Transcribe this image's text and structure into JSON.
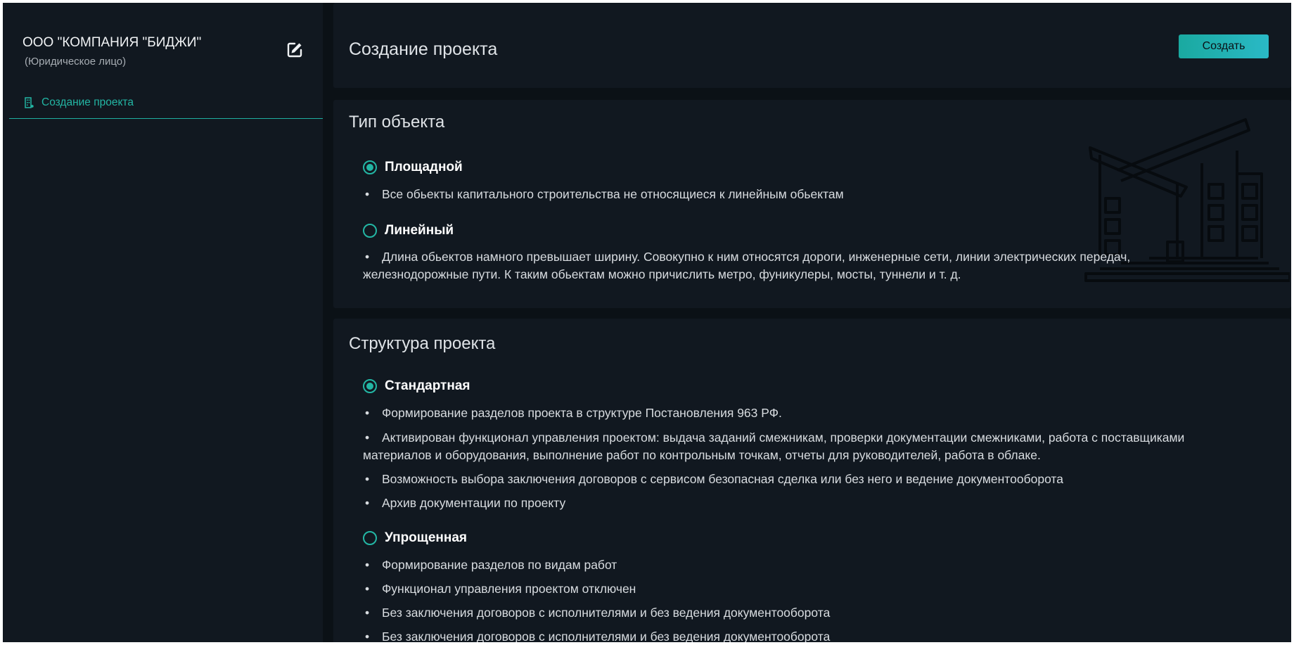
{
  "sidebar": {
    "org_name": "ООО \"КОМПАНИЯ \"БИДЖИ\"",
    "org_type": "(Юридическое лицо)",
    "nav_item": "Создание проекта"
  },
  "header": {
    "title": "Создание проекта",
    "create_button": "Создать"
  },
  "object_type": {
    "title": "Тип объекта",
    "options": [
      {
        "label": "Площадной",
        "selected": true,
        "bullets": [
          "Все обьекты капитального строительства не относящиеся к линейным обьектам"
        ]
      },
      {
        "label": "Линейный",
        "selected": false,
        "bullets": [
          "Длина обьектов намного превышает ширину. Совокупно к ним относятся дороги, инженерные сети, линии электрических передач, железнодорожные пути. К таким обьектам можно причислить метро, фуникулеры, мосты, туннели и т. д."
        ]
      }
    ]
  },
  "structure": {
    "title": "Структура проекта",
    "options": [
      {
        "label": "Стандартная",
        "selected": true,
        "bullets": [
          "Формирование разделов проекта в структуре Постановления 963 РФ.",
          "Активирован функционал управления проектом: выдача заданий смежникам, проверки документации смежниками, работа с поставщиками материалов и оборудования, выполнение работ по контрольным точкам, отчеты для руководителей, работа в облаке.",
          "Возможность выбора заключения договоров с сервисом безопасная сделка или без него и ведение документооборота",
          "Архив документации по проекту"
        ]
      },
      {
        "label": "Упрощенная",
        "selected": false,
        "bullets": [
          "Формирование разделов по видам работ",
          "Функционал управления проектом отключен",
          "Без заключения договоров с исполнителями и без ведения документооборота",
          "Без заключения договоров с исполнителями и без ведения документооборота"
        ]
      }
    ]
  },
  "icons": {
    "edit": "edit-icon",
    "nav": "building-icon",
    "illustration": "building-illustration"
  },
  "colors": {
    "accent": "#23b6a4",
    "background": "#0b1116",
    "panel": "#111820",
    "button_gradient_start": "#1aa9a0",
    "button_gradient_end": "#2ab9c6"
  }
}
